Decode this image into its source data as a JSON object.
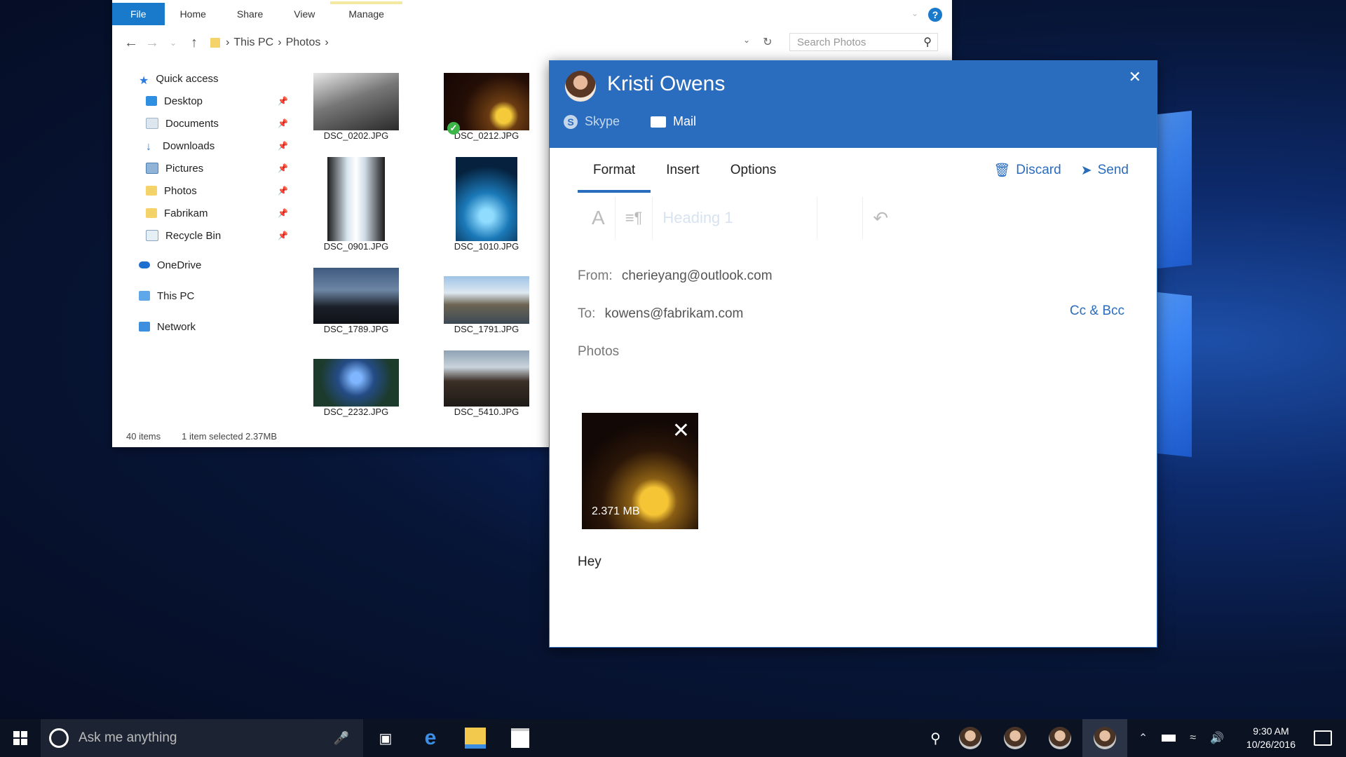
{
  "explorer": {
    "ribbon_tabs": [
      "File",
      "Home",
      "Share",
      "View",
      "Manage"
    ],
    "breadcrumb": [
      "This PC",
      "Photos"
    ],
    "search_placeholder": "Search Photos",
    "nav": {
      "quick_access": "Quick access",
      "pinned": [
        "Desktop",
        "Documents",
        "Downloads",
        "Pictures",
        "Photos",
        "Fabrikam",
        "Recycle Bin"
      ],
      "onedrive": "OneDrive",
      "this_pc": "This PC",
      "network": "Network"
    },
    "files": [
      "DSC_0202.JPG",
      "DSC_0212.JPG",
      "DSC_0901.JPG",
      "DSC_1010.JPG",
      "DSC_1789.JPG",
      "DSC_1791.JPG",
      "DSC_2232.JPG",
      "DSC_5410.JPG"
    ],
    "status": {
      "count": "40 items",
      "selection": "1 item selected  2.37MB"
    }
  },
  "mail": {
    "contact_name": "Kristi Owens",
    "tabs": [
      "Skype",
      "Mail"
    ],
    "toolbar_tabs": [
      "Format",
      "Insert",
      "Options"
    ],
    "discard": "Discard",
    "send": "Send",
    "heading_style": "Heading 1",
    "from_label": "From:",
    "from_value": "cherieyang@outlook.com",
    "to_label": "To:",
    "to_value": "kowens@fabrikam.com",
    "cc_bcc": "Cc & Bcc",
    "subject": "Photos",
    "attachment_size": "2.371 MB",
    "body": "Hey"
  },
  "taskbar": {
    "search_placeholder": "Ask me anything",
    "time": "9:30 AM",
    "date": "10/26/2016"
  },
  "colors": {
    "accent": "#2a6cbd",
    "file_tab": "#1979ca",
    "taskbar": "#0b1323"
  }
}
